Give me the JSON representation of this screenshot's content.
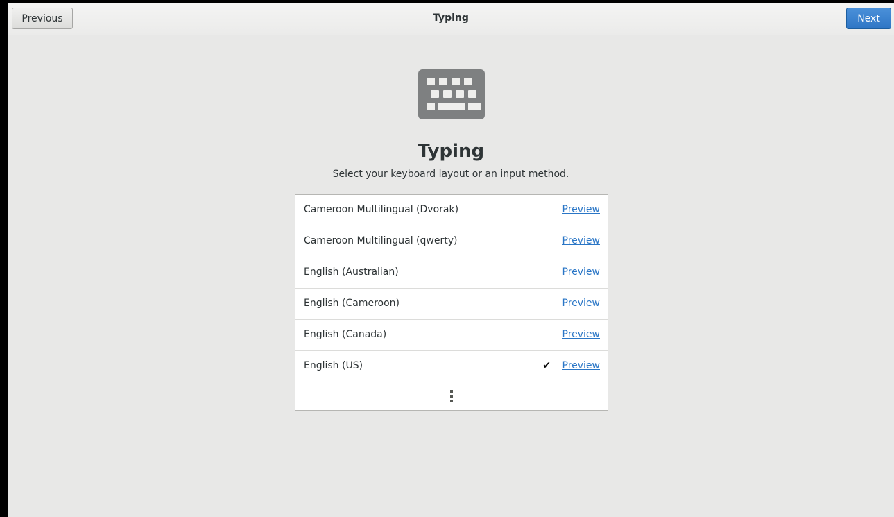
{
  "header": {
    "title": "Typing",
    "previous_label": "Previous",
    "next_label": "Next"
  },
  "page": {
    "icon": "keyboard-icon",
    "title": "Typing",
    "subtitle": "Select your keyboard layout or an input method."
  },
  "layouts": [
    {
      "label": "Cameroon Multilingual (Dvorak)",
      "preview": "Preview",
      "selected": false
    },
    {
      "label": "Cameroon Multilingual (qwerty)",
      "preview": "Preview",
      "selected": false
    },
    {
      "label": "English (Australian)",
      "preview": "Preview",
      "selected": false
    },
    {
      "label": "English (Cameroon)",
      "preview": "Preview",
      "selected": false
    },
    {
      "label": "English (Canada)",
      "preview": "Preview",
      "selected": false
    },
    {
      "label": "English (US)",
      "preview": "Preview",
      "selected": true
    }
  ],
  "more_icon": "more-vertical-icon",
  "colors": {
    "accent": "#2f76c5",
    "link": "#2a76c6",
    "background": "#e8e8e7"
  }
}
